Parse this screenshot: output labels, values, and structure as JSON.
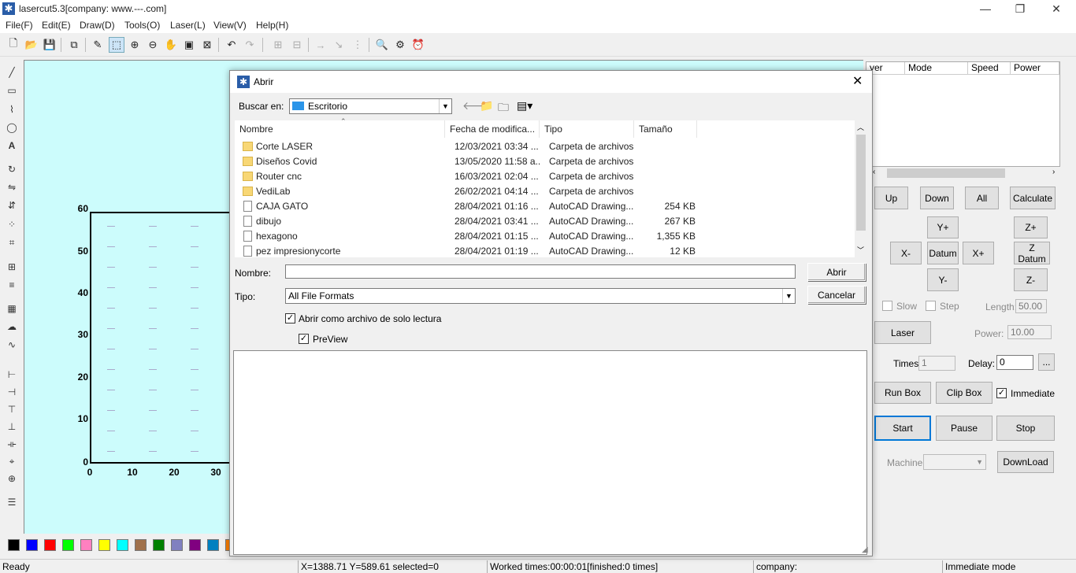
{
  "app": {
    "title": "lasercut5.3[company: www.---.com]",
    "menu": [
      "File(F)",
      "Edit(E)",
      "Draw(D)",
      "Tools(O)",
      "Laser(L)",
      "View(V)",
      "Help(H)"
    ],
    "window_buttons": {
      "minimize": "—",
      "restore": "❐",
      "close": "✕"
    }
  },
  "canvas": {
    "y_ticks": [
      "60",
      "50",
      "40",
      "30",
      "20",
      "10",
      "0"
    ],
    "x_ticks": [
      "0",
      "10",
      "20",
      "30"
    ]
  },
  "layer_table": {
    "columns": [
      "yer",
      "Mode",
      "Speed",
      "Power"
    ]
  },
  "panel": {
    "up": "Up",
    "down": "Down",
    "all": "All",
    "calculate": "Calculate",
    "yplus": "Y+",
    "zplus": "Z+",
    "xminus": "X-",
    "datum": "Datum",
    "xplus": "X+",
    "zdatum": "Z Datum",
    "yminus": "Y-",
    "zminus": "Z-",
    "slow": "Slow",
    "step": "Step",
    "length_label": "Length:",
    "length_value": "50.00",
    "laser": "Laser",
    "power_label": "Power:",
    "power_value": "10.00",
    "times_label": "Times:",
    "times_value": "1",
    "delay_label": "Delay:",
    "delay_value": "0",
    "ellipsis": "...",
    "run_box": "Run Box",
    "clip_box": "Clip Box",
    "immediate": "Immediate",
    "start": "Start",
    "pause": "Pause",
    "stop": "Stop",
    "machine_label": "Machine:",
    "download": "DownLoad"
  },
  "palette_colors": [
    "#000000",
    "#0000ff",
    "#ff0000",
    "#00ff00",
    "#ff80c0",
    "#ffff00",
    "#00ffff",
    "#a0704a",
    "#008000",
    "#8080c0",
    "#800080",
    "#0080c0",
    "#ff8000"
  ],
  "status": {
    "ready": "Ready",
    "coords": "X=1388.71 Y=589.61 selected=0",
    "worked": "Worked times:00:00:01[finished:0 times]",
    "company": "company:",
    "mode": "Immediate mode"
  },
  "dialog": {
    "title": "Abrir",
    "look_in_label": "Buscar en:",
    "look_in_value": "Escritorio",
    "columns": [
      "Nombre",
      "Fecha de modifica...",
      "Tipo",
      "Tamaño"
    ],
    "files": [
      {
        "name": "Corte LASER",
        "date": "12/03/2021 03:34 ...",
        "type": "Carpeta de archivos",
        "size": "",
        "folder": true
      },
      {
        "name": "Diseños Covid",
        "date": "13/05/2020 11:58 a...",
        "type": "Carpeta de archivos",
        "size": "",
        "folder": true
      },
      {
        "name": "Router cnc",
        "date": "16/03/2021 02:04 ...",
        "type": "Carpeta de archivos",
        "size": "",
        "folder": true
      },
      {
        "name": "VediLab",
        "date": "26/02/2021 04:14 ...",
        "type": "Carpeta de archivos",
        "size": "",
        "folder": true
      },
      {
        "name": "CAJA GATO",
        "date": "28/04/2021 01:16 ...",
        "type": "AutoCAD Drawing...",
        "size": "254 KB",
        "folder": false
      },
      {
        "name": "dibujo",
        "date": "28/04/2021 03:41 ...",
        "type": "AutoCAD Drawing...",
        "size": "267 KB",
        "folder": false
      },
      {
        "name": "hexagono",
        "date": "28/04/2021 01:15 ...",
        "type": "AutoCAD Drawing...",
        "size": "1,355 KB",
        "folder": false
      },
      {
        "name": "pez impresionycorte",
        "date": "28/04/2021 01:19 ...",
        "type": "AutoCAD Drawing...",
        "size": "12 KB",
        "folder": false
      }
    ],
    "name_label": "Nombre:",
    "name_value": "",
    "type_label": "Tipo:",
    "type_value": "All File Formats",
    "open_button": "Abrir",
    "cancel_button": "Cancelar",
    "readonly_label": "Abrir como archivo de solo lectura",
    "preview_label": "PreView"
  }
}
